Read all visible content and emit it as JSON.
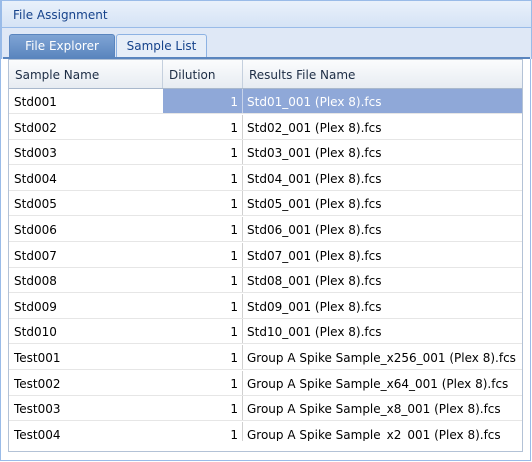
{
  "panel": {
    "title": "File Assignment"
  },
  "tabs": [
    {
      "label": "File Explorer",
      "active": true
    },
    {
      "label": "Sample List",
      "active": false
    }
  ],
  "grid": {
    "columns": [
      "Sample Name",
      "Dilution",
      "Results File Name"
    ],
    "selected_row": 0,
    "rows": [
      {
        "sample": "Std001",
        "dilution": "1",
        "file": "Std01_001 (Plex 8).fcs"
      },
      {
        "sample": "Std002",
        "dilution": "1",
        "file": "Std02_001 (Plex 8).fcs"
      },
      {
        "sample": "Std003",
        "dilution": "1",
        "file": "Std03_001 (Plex 8).fcs"
      },
      {
        "sample": "Std004",
        "dilution": "1",
        "file": "Std04_001 (Plex 8).fcs"
      },
      {
        "sample": "Std005",
        "dilution": "1",
        "file": "Std05_001 (Plex 8).fcs"
      },
      {
        "sample": "Std006",
        "dilution": "1",
        "file": "Std06_001 (Plex 8).fcs"
      },
      {
        "sample": "Std007",
        "dilution": "1",
        "file": "Std07_001 (Plex 8).fcs"
      },
      {
        "sample": "Std008",
        "dilution": "1",
        "file": "Std08_001 (Plex 8).fcs"
      },
      {
        "sample": "Std009",
        "dilution": "1",
        "file": "Std09_001 (Plex 8).fcs"
      },
      {
        "sample": "Std010",
        "dilution": "1",
        "file": "Std10_001 (Plex 8).fcs"
      },
      {
        "sample": "Test001",
        "dilution": "1",
        "file": "Group A Spike Sample_x256_001 (Plex 8).fcs"
      },
      {
        "sample": "Test002",
        "dilution": "1",
        "file": "Group A Spike Sample_x64_001 (Plex 8).fcs"
      },
      {
        "sample": "Test003",
        "dilution": "1",
        "file": "Group A Spike Sample_x8_001 (Plex 8).fcs"
      },
      {
        "sample": "Test004",
        "dilution": "1",
        "file": "Group A Spike Sample_x2_001 (Plex 8).fcs"
      }
    ]
  }
}
